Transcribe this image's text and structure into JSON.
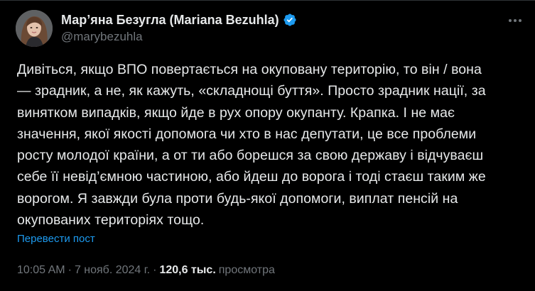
{
  "author": {
    "display_name": "Мар’яна Безугла (Mariana Bezuhla)",
    "handle": "@marybezuhla",
    "verified_icon": "verified-badge-icon",
    "verified_color": "#1d9bf0"
  },
  "more_icon": "more-dots-icon",
  "tweet": {
    "lines": [
      "Дивіться, якщо ВПО повертається на окуповану територію, то він / вона",
      "— зрадник, а не, як кажуть, «складнощі буття». Просто зрадник нації, за",
      "винятком випадків, якщо йде в рух опору окупанту. Крапка. І не має",
      "значення, якої якості допомога чи хто в нас депутати, це все проблеми",
      "росту молодої країни, а от ти або борешся за свою державу і відчуваєш",
      "себе її невід’ємною частиною, або йдеш до ворога і тоді стаєш таким же",
      "ворогом. Я завжди була проти будь-якої допомоги, виплат пенсій на",
      "окупованих територіях тощо."
    ]
  },
  "translate_label": "Перевести пост",
  "meta": {
    "time": "10:05 AM",
    "separator1": "·",
    "date": "7 нояб. 2024 г.",
    "separator2": "·",
    "views_count": "120,6 тыс.",
    "views_label": "просмотра"
  },
  "colors": {
    "background": "#000000",
    "text": "#e7e9ea",
    "secondary": "#71767b",
    "link": "#1d9bf0"
  }
}
